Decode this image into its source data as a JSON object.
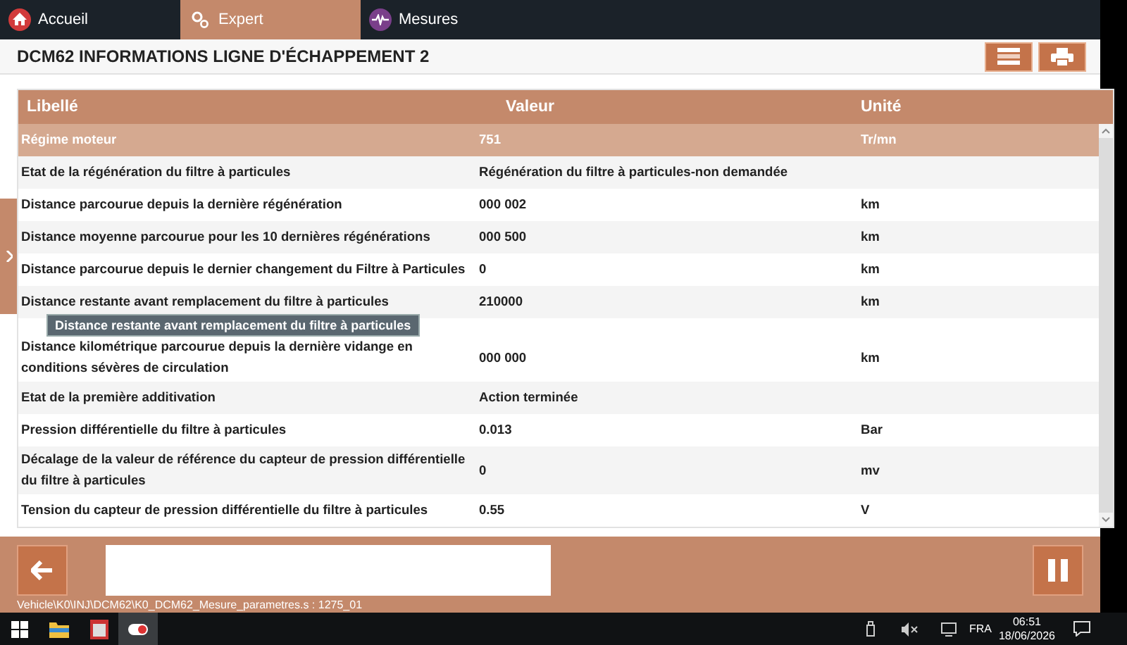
{
  "tabs": [
    {
      "label": "Accueil",
      "selected": false
    },
    {
      "label": "Expert",
      "selected": true
    },
    {
      "label": "Mesures",
      "selected": false
    }
  ],
  "title": "DCM62 INFORMATIONS LIGNE D'ÉCHAPPEMENT 2",
  "table": {
    "columns": [
      "Libellé",
      "Valeur",
      "Unité"
    ],
    "rows": [
      {
        "label": "Régime moteur",
        "value": "751",
        "unit": "Tr/mn",
        "selected": true
      },
      {
        "label": "Etat de la régénération du filtre à particules",
        "value": "Régénération du filtre à particules-non demandée",
        "unit": "",
        "selected": false
      },
      {
        "label": "Distance parcourue depuis la dernière régénération",
        "value": "000 002",
        "unit": "km",
        "selected": false
      },
      {
        "label": "Distance moyenne parcourue pour les 10 dernières régénérations",
        "value": "000 500",
        "unit": "km",
        "selected": false
      },
      {
        "label": "Distance parcourue depuis le dernier changement du Filtre à Particules",
        "value": "0",
        "unit": "km",
        "selected": false
      },
      {
        "label": "Distance restante avant remplacement du filtre à particules",
        "value": "210000",
        "unit": "km",
        "selected": false
      },
      {
        "label": "Distance kilométrique parcourue depuis la dernière vidange en conditions sévères de circulation",
        "value": "000 000",
        "unit": "km",
        "selected": false
      },
      {
        "label": "Etat de la première additivation",
        "value": "Action terminée",
        "unit": "",
        "selected": false
      },
      {
        "label": "Pression différentielle du filtre à particules",
        "value": "0.013",
        "unit": "Bar",
        "selected": false
      },
      {
        "label": "Décalage de la valeur de référence du capteur de pression différentielle du filtre à particules",
        "value": "0",
        "unit": "mv",
        "selected": false
      },
      {
        "label": "Tension du capteur de pression différentielle du filtre à particules",
        "value": "0.55",
        "unit": "V",
        "selected": false
      }
    ]
  },
  "tooltip": "Distance restante avant remplacement du filtre à particules",
  "path": "Vehicle\\K0\\INJ\\DCM62\\K0_DCM62_Mesure_parametres.s : 1275_01",
  "taskbar": {
    "language": "FRA",
    "time": "06:51",
    "date": "18/06/2026"
  }
}
